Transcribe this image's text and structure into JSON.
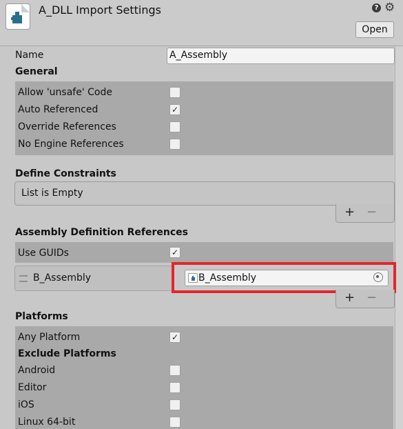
{
  "header": {
    "title": "A_DLL Import Settings",
    "open_label": "Open",
    "help_glyph": "?",
    "settings_glyph": "⚙"
  },
  "name_label": "Name",
  "name_value": "A_Assembly",
  "general": {
    "heading": "General",
    "options": [
      {
        "label": "Allow 'unsafe' Code",
        "checked": false
      },
      {
        "label": "Auto Referenced",
        "checked": true
      },
      {
        "label": "Override References",
        "checked": false
      },
      {
        "label": "No Engine References",
        "checked": false
      }
    ]
  },
  "define_constraints": {
    "heading": "Define Constraints",
    "empty_text": "List is Empty",
    "add_glyph": "+",
    "remove_glyph": "−"
  },
  "assembly_refs": {
    "heading": "Assembly Definition References",
    "use_guids_label": "Use GUIDs",
    "use_guids_checked": true,
    "reference_label": "B_Assembly",
    "reference_value": "B_Assembly",
    "add_glyph": "+",
    "remove_glyph": "−"
  },
  "platforms": {
    "heading": "Platforms",
    "any_platform_label": "Any Platform",
    "any_platform_checked": true,
    "exclude_heading": "Exclude Platforms",
    "items": [
      {
        "label": "Android",
        "checked": false
      },
      {
        "label": "Editor",
        "checked": false
      },
      {
        "label": "iOS",
        "checked": false
      },
      {
        "label": "Linux 64-bit",
        "checked": false
      }
    ]
  },
  "check_glyph": "✓",
  "icons": {
    "asset": "dll-asset-icon",
    "help": "help-icon",
    "settings": "settings-icon",
    "picker": "object-picker-icon",
    "drag": "drag-handle-icon"
  },
  "colors": {
    "panel_bg": "#a9a9a9",
    "window_bg": "#c8c8c8",
    "highlight": "#e3252d",
    "icon_teal": "#2b6f8e"
  }
}
